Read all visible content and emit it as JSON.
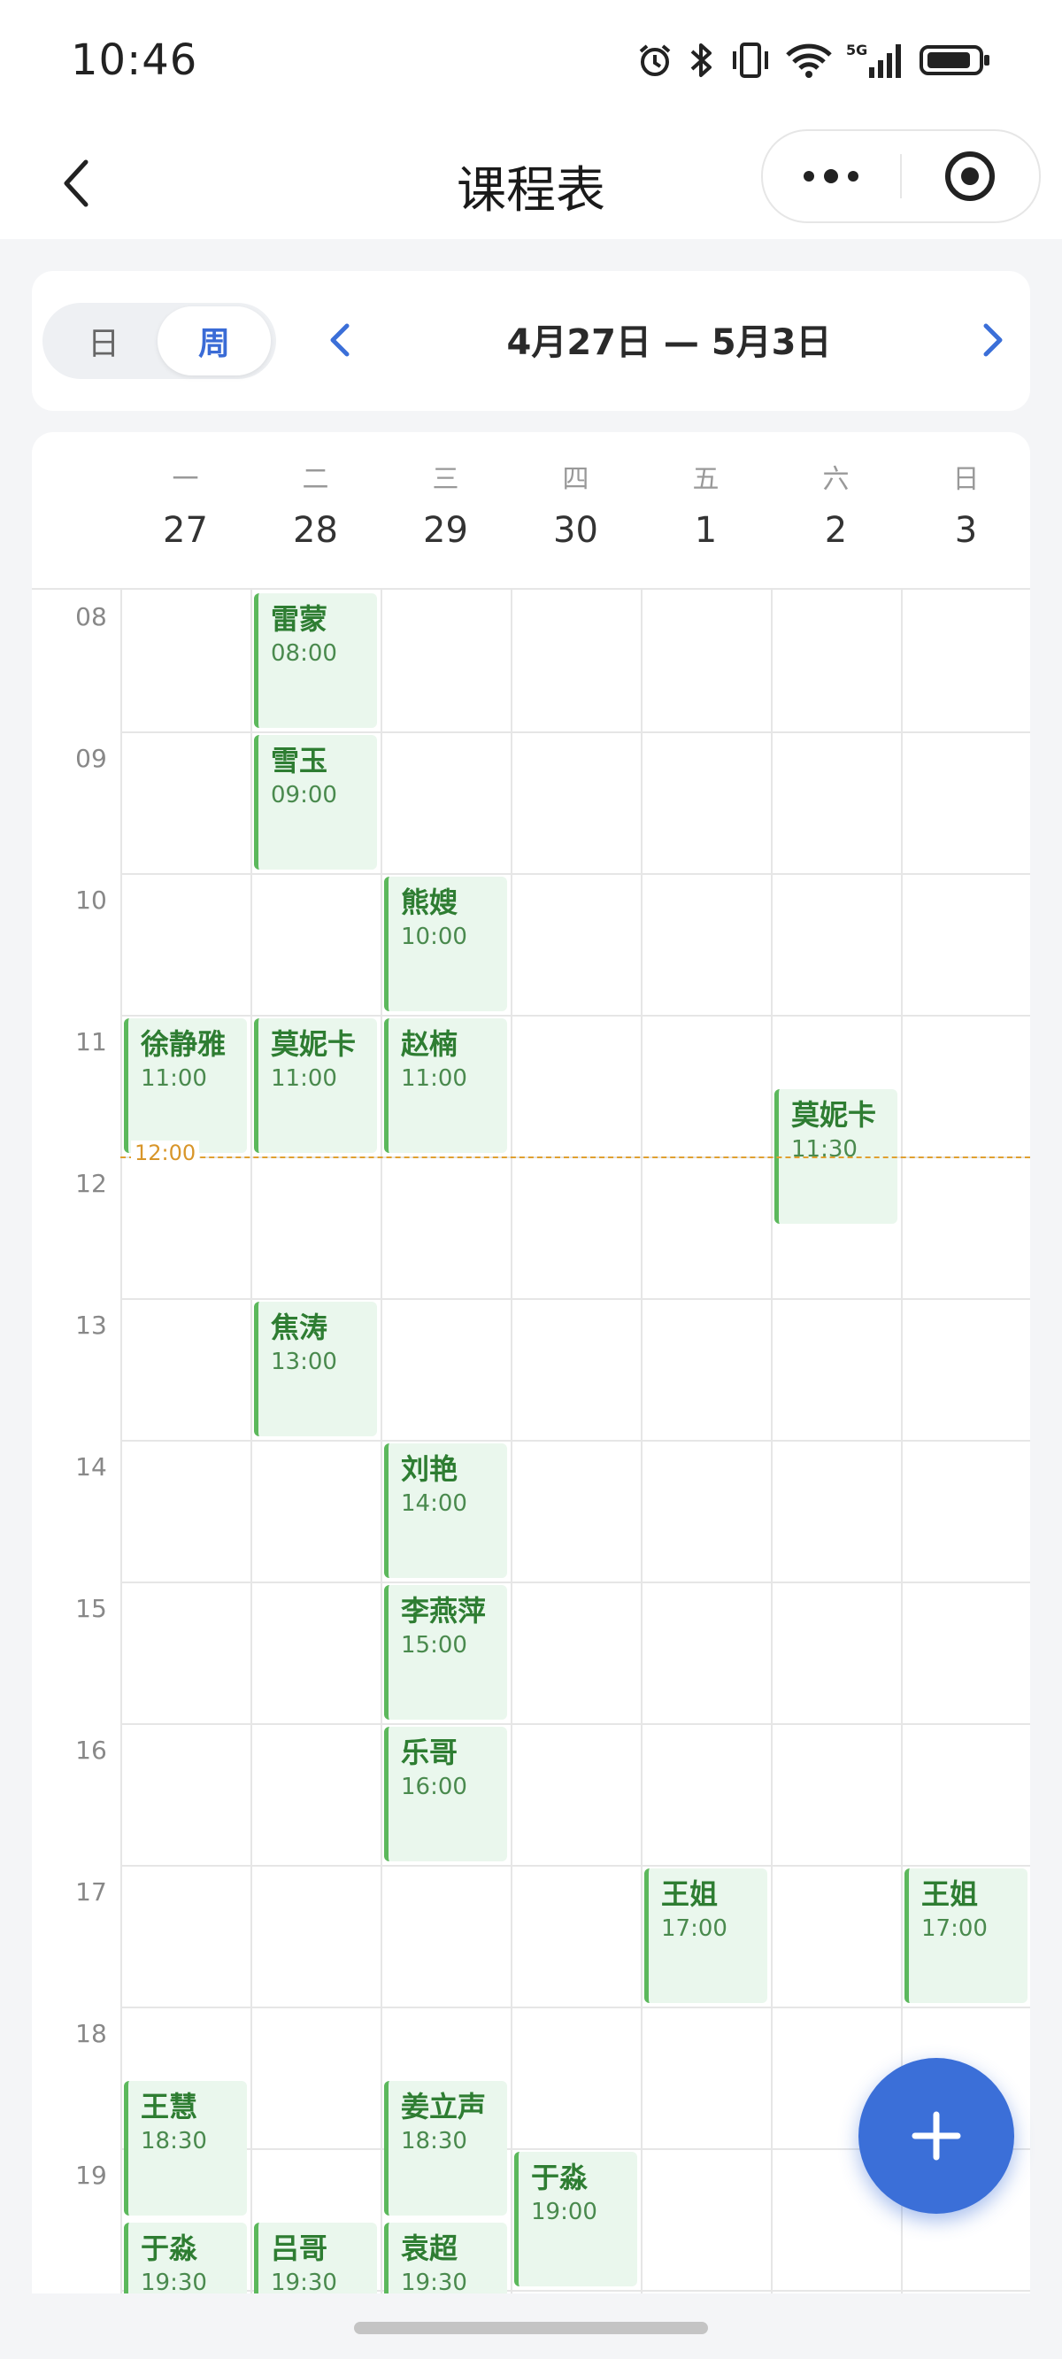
{
  "status_bar": {
    "time": "10:46",
    "icons": [
      "alarm-icon",
      "bluetooth-icon",
      "vibrate-icon",
      "wifi-icon",
      "5g-signal-icon",
      "battery-icon"
    ]
  },
  "nav": {
    "title": "课程表",
    "back_icon": "chevron-left-icon",
    "more_icon": "more-dots-icon",
    "target_icon": "target-icon"
  },
  "view_toggle": {
    "day_label": "日",
    "week_label": "周",
    "selected": "周"
  },
  "week_range": "4月27日 — 5月3日",
  "days": [
    {
      "weekday": "一",
      "date": "27"
    },
    {
      "weekday": "二",
      "date": "28"
    },
    {
      "weekday": "三",
      "date": "29"
    },
    {
      "weekday": "四",
      "date": "30"
    },
    {
      "weekday": "五",
      "date": "1"
    },
    {
      "weekday": "六",
      "date": "2"
    },
    {
      "weekday": "日",
      "date": "3"
    }
  ],
  "hours": [
    "08",
    "09",
    "10",
    "11",
    "12",
    "13",
    "14",
    "15",
    "16",
    "17",
    "18",
    "19"
  ],
  "current_time": "12:00",
  "events": [
    {
      "name": "雷蒙",
      "time": "08:00",
      "day": 1,
      "start": 8.0,
      "duration": 1
    },
    {
      "name": "雪玉",
      "time": "09:00",
      "day": 1,
      "start": 9.0,
      "duration": 1
    },
    {
      "name": "熊嫂",
      "time": "10:00",
      "day": 2,
      "start": 10.0,
      "duration": 1
    },
    {
      "name": "徐静雅",
      "time": "11:00",
      "day": 0,
      "start": 11.0,
      "duration": 1
    },
    {
      "name": "莫妮卡",
      "time": "11:00",
      "day": 1,
      "start": 11.0,
      "duration": 1
    },
    {
      "name": "赵楠",
      "time": "11:00",
      "day": 2,
      "start": 11.0,
      "duration": 1
    },
    {
      "name": "莫妮卡",
      "time": "11:30",
      "day": 5,
      "start": 11.5,
      "duration": 1
    },
    {
      "name": "焦涛",
      "time": "13:00",
      "day": 1,
      "start": 13.0,
      "duration": 1
    },
    {
      "name": "刘艳",
      "time": "14:00",
      "day": 2,
      "start": 14.0,
      "duration": 1
    },
    {
      "name": "李燕萍",
      "time": "15:00",
      "day": 2,
      "start": 15.0,
      "duration": 1
    },
    {
      "name": "乐哥",
      "time": "16:00",
      "day": 2,
      "start": 16.0,
      "duration": 1
    },
    {
      "name": "王姐",
      "time": "17:00",
      "day": 4,
      "start": 17.0,
      "duration": 1
    },
    {
      "name": "王姐",
      "time": "17:00",
      "day": 6,
      "start": 17.0,
      "duration": 1
    },
    {
      "name": "王慧",
      "time": "18:30",
      "day": 0,
      "start": 18.5,
      "duration": 1
    },
    {
      "name": "姜立声",
      "time": "18:30",
      "day": 2,
      "start": 18.5,
      "duration": 1
    },
    {
      "name": "于淼",
      "time": "19:00",
      "day": 3,
      "start": 19.0,
      "duration": 1
    },
    {
      "name": "于淼",
      "time": "19:30",
      "day": 0,
      "start": 19.5,
      "duration": 1
    },
    {
      "name": "吕哥",
      "time": "19:30",
      "day": 1,
      "start": 19.5,
      "duration": 1
    },
    {
      "name": "袁超",
      "time": "19:30",
      "day": 2,
      "start": 19.5,
      "duration": 1
    }
  ],
  "fab_icon": "plus-icon",
  "colors": {
    "accent": "#3b6fd8",
    "event_bg": "#eaf7ed",
    "event_border": "#5cb85c",
    "event_text": "#2e7d32",
    "now_line": "#e0a030"
  }
}
